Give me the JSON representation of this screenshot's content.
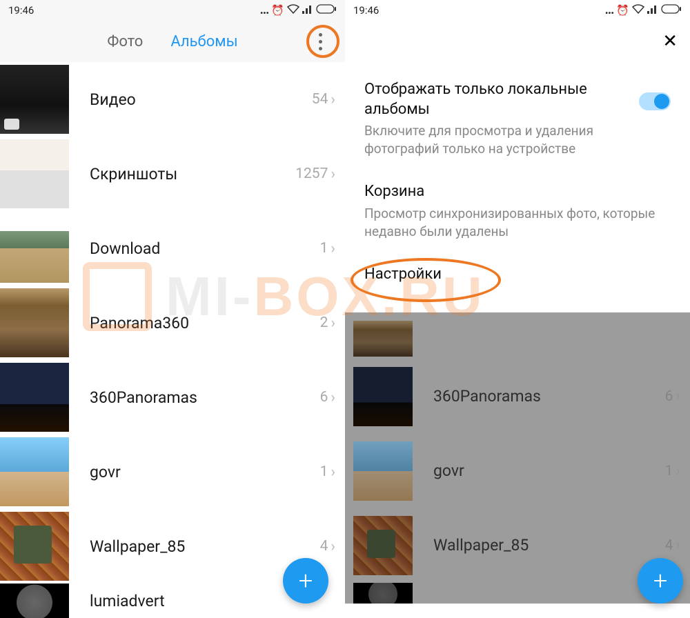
{
  "status": {
    "time": "19:46"
  },
  "left": {
    "tabs": {
      "photo": "Фото",
      "albums": "Альбомы"
    },
    "albums": [
      {
        "title": "Видео",
        "count": "54"
      },
      {
        "title": "Скриншоты",
        "count": "1257"
      },
      {
        "title": "Download",
        "count": "1"
      },
      {
        "title": "Panorama360",
        "count": "2"
      },
      {
        "title": "360Panoramas",
        "count": "6"
      },
      {
        "title": "govr",
        "count": "1"
      },
      {
        "title": "Wallpaper_85",
        "count": "4"
      },
      {
        "title": "lumiadvert",
        "count": ""
      }
    ]
  },
  "right": {
    "settings": {
      "local_title": "Отображать только локальные альбомы",
      "local_sub": "Включите для просмотра и удаления фотографий только на устройстве",
      "trash_title": "Корзина",
      "trash_sub": "Просмотр синхронизированных фото, которые недавно были удалены",
      "settings_title": "Настройки"
    },
    "albums": [
      {
        "title": "360Panoramas",
        "count": "6"
      },
      {
        "title": "govr",
        "count": "1"
      },
      {
        "title": "Wallpaper_85",
        "count": "4"
      }
    ]
  },
  "watermark": {
    "prefix": "MI-",
    "suffix": "BOX.RU"
  }
}
